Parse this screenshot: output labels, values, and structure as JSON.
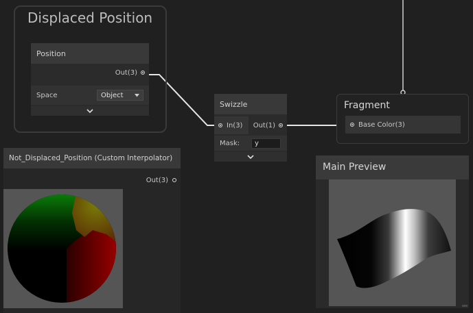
{
  "groups": {
    "displaced_position": {
      "title": "Displaced Position"
    }
  },
  "nodes": {
    "position": {
      "title": "Position",
      "output_label": "Out(3)",
      "space_label": "Space",
      "space_value": "Object"
    },
    "swizzle": {
      "title": "Swizzle",
      "input_label": "In(3)",
      "output_label": "Out(1)",
      "mask_label": "Mask:",
      "mask_value": "y"
    },
    "fragment": {
      "title": "Fragment",
      "input_label": "Base Color(3)"
    },
    "custom_interpolator": {
      "title": "Not_Displaced_Position (Custom Interpolator)",
      "output_label": "Out(3)"
    }
  },
  "main_preview": {
    "title": "Main Preview"
  },
  "colors": {
    "background": "#202020",
    "node_body": "#2b2b2b",
    "node_header": "#393939",
    "wire": "#e8e8e8",
    "preview_bg": "#555555"
  },
  "icons": [
    "chevron-down-icon",
    "dropdown-arrow-icon",
    "port-icon"
  ]
}
